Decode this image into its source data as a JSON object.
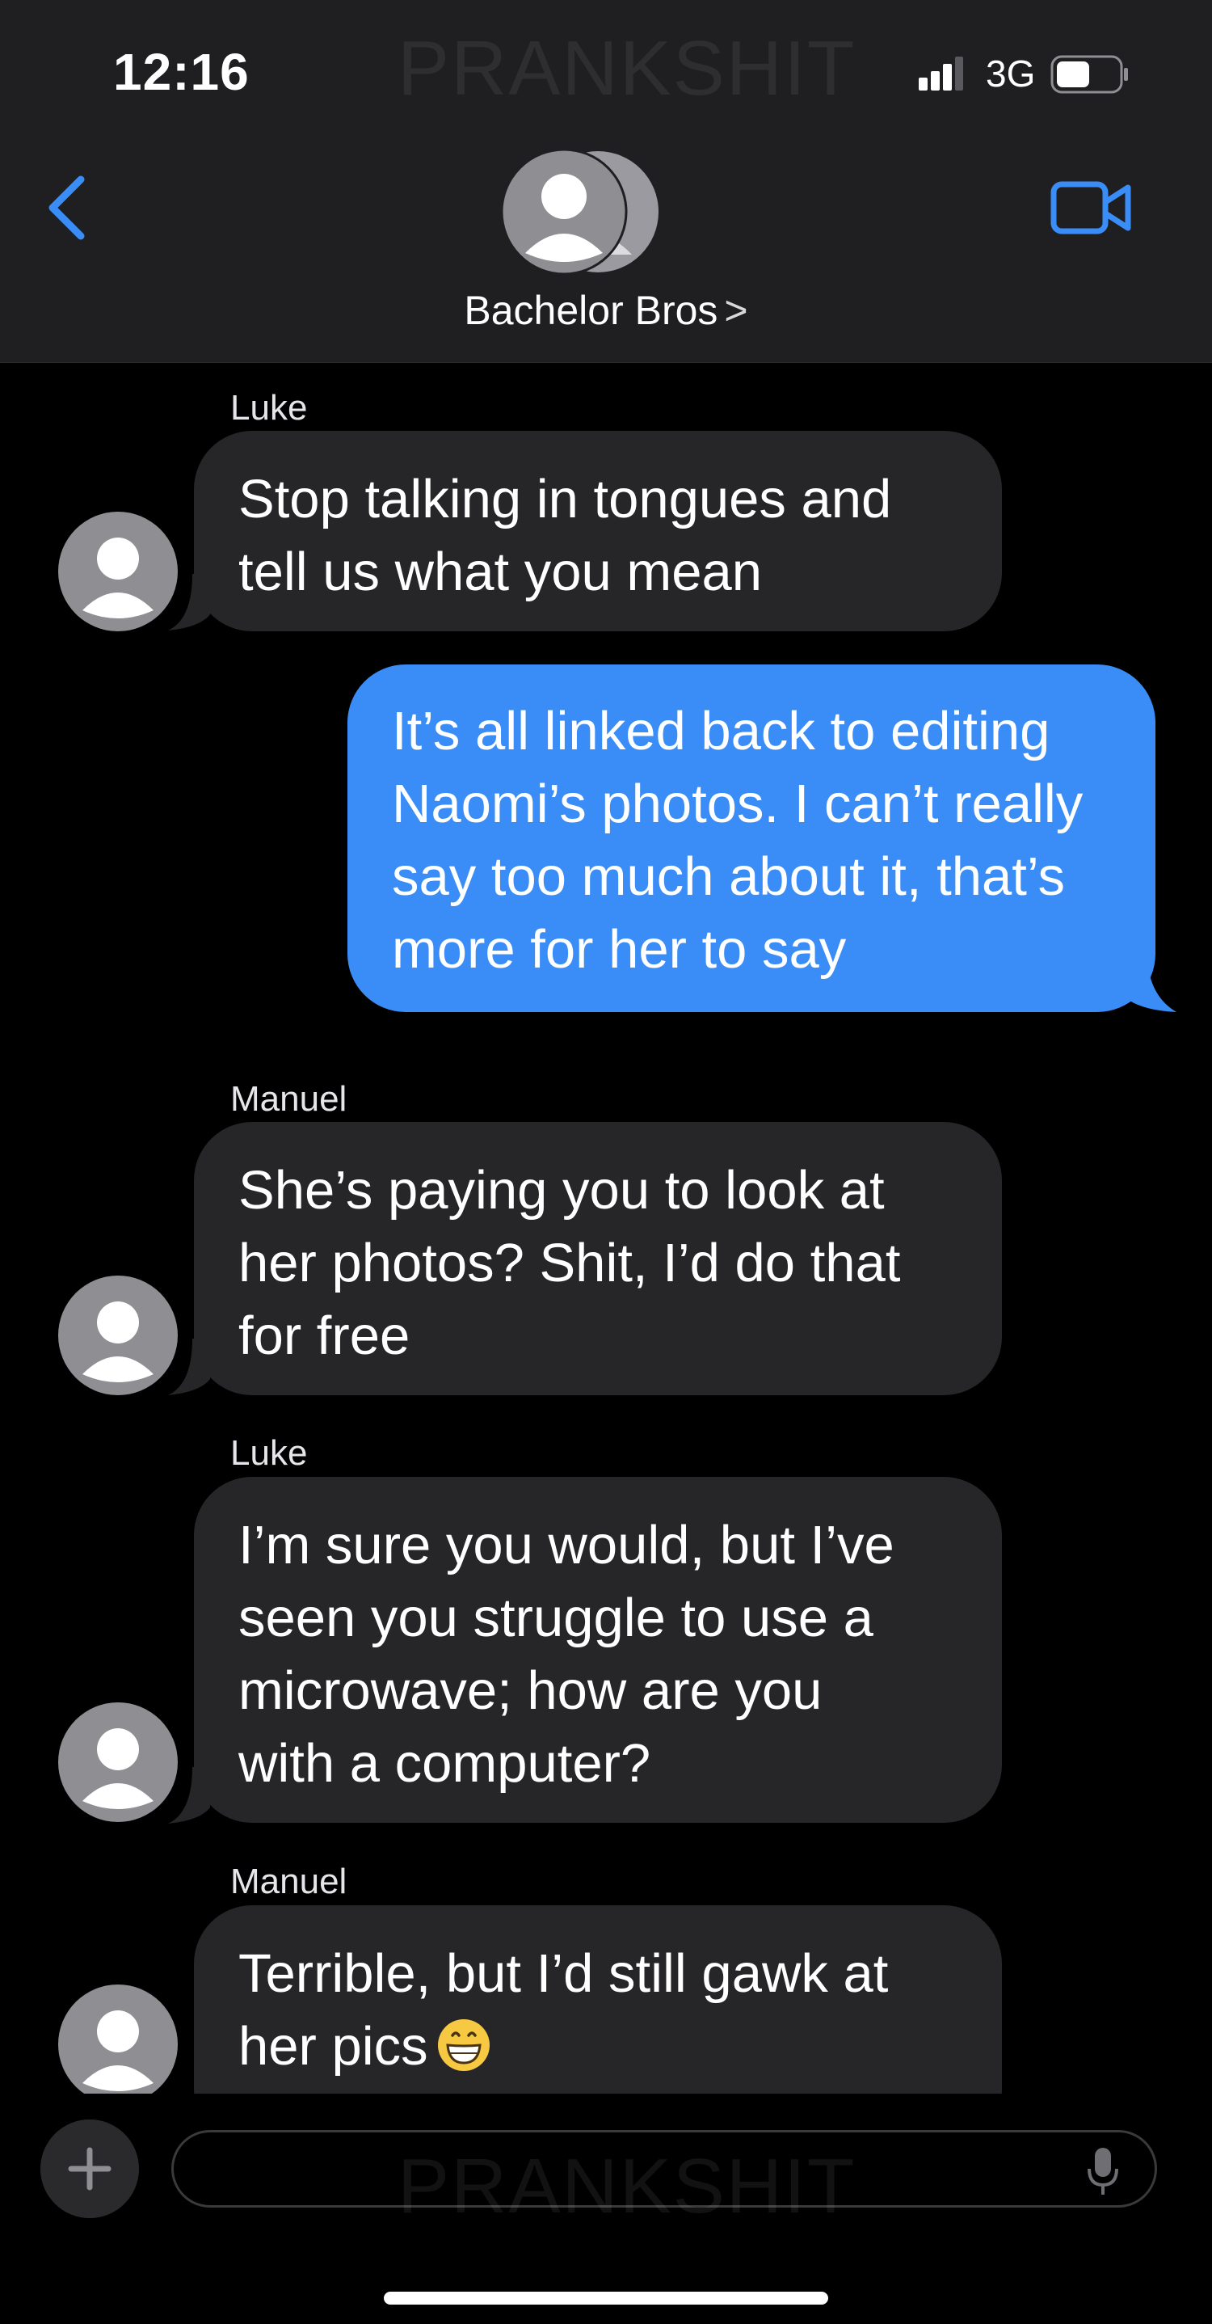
{
  "status_bar": {
    "time": "12:16",
    "network": "3G"
  },
  "watermark": "PRANKSHIT",
  "header": {
    "title": "Bachelor Bros",
    "chevron": ">"
  },
  "icons": {
    "back": "chevron-left-icon",
    "video": "video-camera-icon",
    "plus": "plus-icon",
    "mic": "microphone-icon",
    "avatar": "person-icon"
  },
  "colors": {
    "accent": "#3a8df7",
    "incoming_bubble": "#262628",
    "header_bg": "#1f1f21"
  },
  "messages": [
    {
      "sender": "Luke",
      "lines": [
        "Stop talking in tongues and",
        "tell us what you mean"
      ]
    },
    {
      "lines": [
        "It’s all linked back to editing",
        "Naomi’s photos. I can’t really",
        "say too much about it, that’s",
        "more for her to say"
      ]
    },
    {
      "sender": "Manuel",
      "lines": [
        "She’s paying you to look at",
        "her photos? Shit, I’d do that",
        "for free"
      ]
    },
    {
      "sender": "Luke",
      "lines": [
        "I’m sure you would, but I’ve",
        "seen you struggle to use a",
        "microwave; how are you",
        "with a computer?"
      ]
    },
    {
      "sender": "Manuel",
      "lines": [
        "Terrible, but I’d still gawk at",
        "her pics"
      ],
      "emoji": "grinning-face-emoji"
    }
  ],
  "composer": {
    "value": "",
    "placeholder": ""
  }
}
